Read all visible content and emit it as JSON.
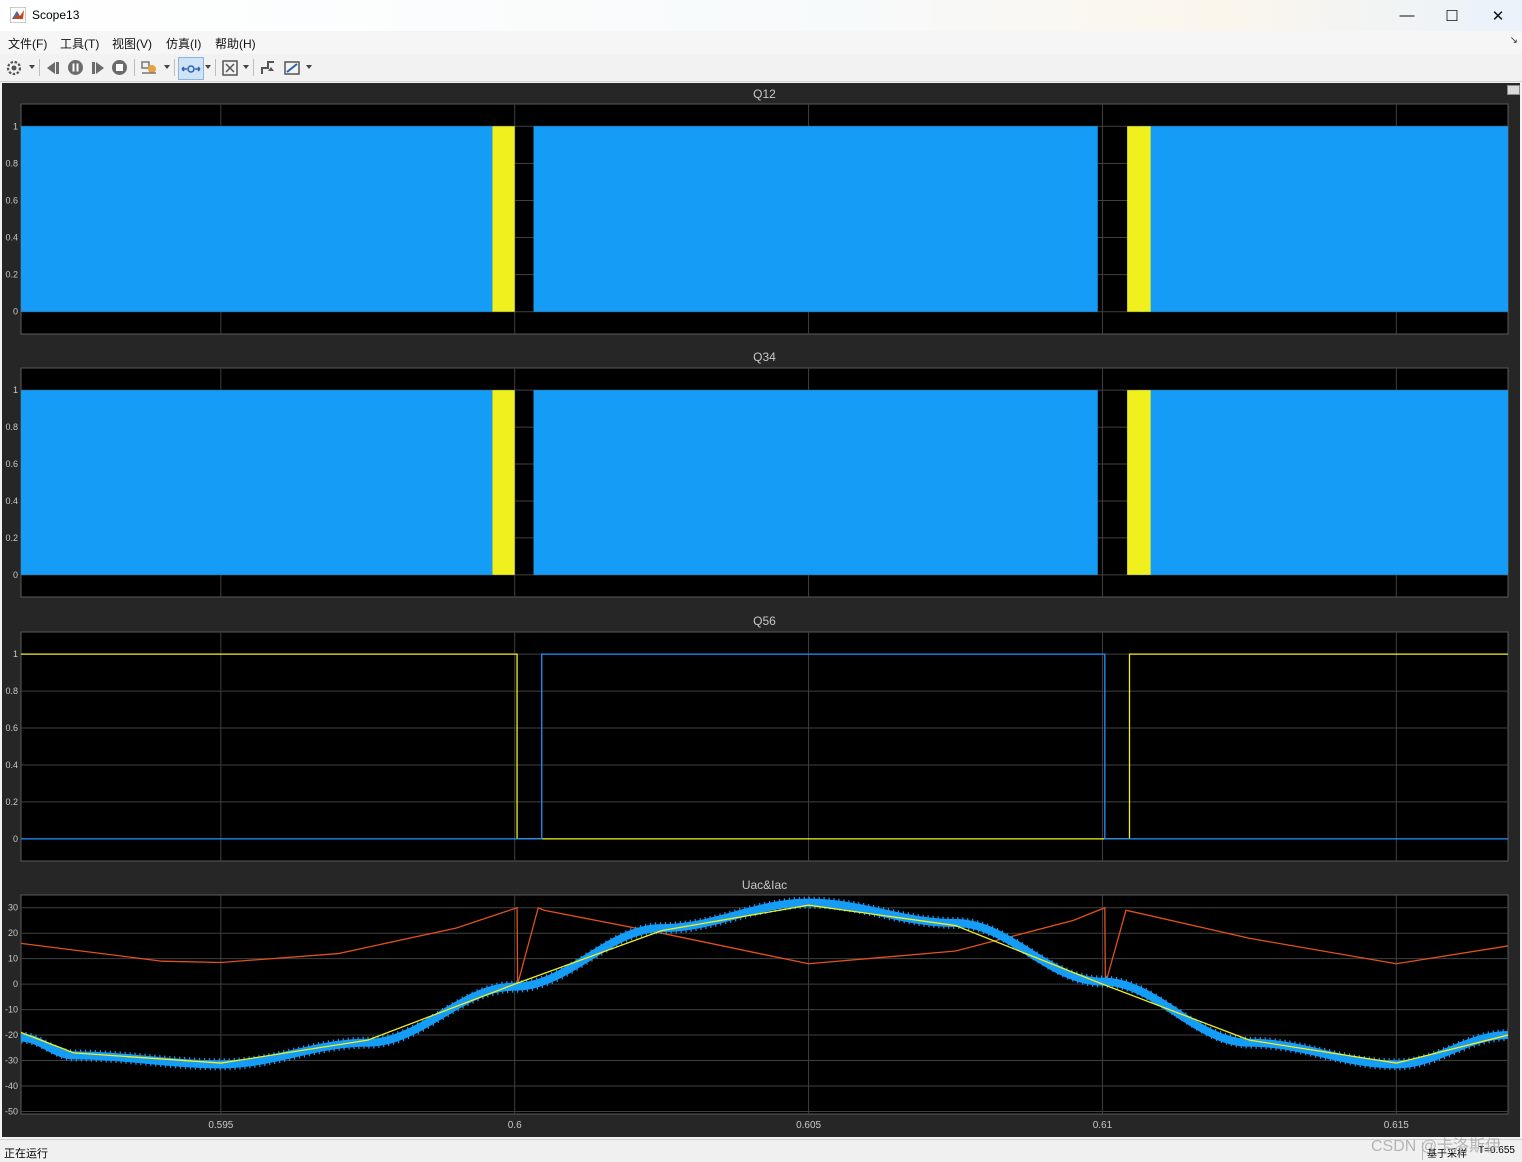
{
  "window": {
    "title": "Scope13",
    "minimize": "—",
    "maximize": "☐",
    "close": "✕"
  },
  "menu": [
    "文件(F)",
    "工具(T)",
    "视图(V)",
    "仿真(I)",
    "帮助(H)"
  ],
  "toolbar": [
    "settings-icon",
    "step-back-icon",
    "pause-icon",
    "step-forward-icon",
    "stop-icon",
    "highlight-icon",
    "zoom-icon",
    "autoscale-icon",
    "trigger-icon",
    "measure-icon"
  ],
  "colors": {
    "plot_bg": "#000000",
    "figure_bg": "#262626",
    "grid": "#404040",
    "axis_text": "#c8c8c8",
    "series_blue": "#149cf7",
    "series_yellow": "#f0f01e",
    "series_orange": "#e0511c",
    "series_blue_line": "#1e90ff"
  },
  "chart_data": [
    {
      "type": "line",
      "title": "Q12",
      "xlim": [
        0.5916,
        0.6169
      ],
      "ylim": [
        -0.12,
        1.12
      ],
      "yticks": [
        0,
        0.2,
        0.4,
        0.6,
        0.8,
        1
      ],
      "ytick_labels": [
        "0",
        "0.2",
        "0.4",
        "0.6",
        "0.8",
        "1"
      ],
      "xgrid": [
        0.595,
        0.6,
        0.605,
        0.61,
        0.615
      ],
      "series": [
        {
          "color": "#149cf7",
          "style": "pwm-fill",
          "intervals": [
            [
              0.5916,
              0.59962
            ],
            [
              0.60032,
              0.60992
            ],
            [
              0.61062,
              0.6169
            ]
          ]
        },
        {
          "color": "#f0f01e",
          "style": "pwm-fill",
          "intervals": [
            [
              0.59962,
              0.6
            ],
            [
              0.61042,
              0.61082
            ]
          ]
        }
      ]
    },
    {
      "type": "line",
      "title": "Q34",
      "xlim": [
        0.5916,
        0.6169
      ],
      "ylim": [
        -0.12,
        1.12
      ],
      "yticks": [
        0,
        0.2,
        0.4,
        0.6,
        0.8,
        1
      ],
      "ytick_labels": [
        "0",
        "0.2",
        "0.4",
        "0.6",
        "0.8",
        "1"
      ],
      "xgrid": [
        0.595,
        0.6,
        0.605,
        0.61,
        0.615
      ],
      "series": [
        {
          "color": "#149cf7",
          "style": "pwm-fill",
          "intervals": [
            [
              0.5916,
              0.59962
            ],
            [
              0.60032,
              0.60992
            ],
            [
              0.61062,
              0.6169
            ]
          ]
        },
        {
          "color": "#f0f01e",
          "style": "pwm-fill",
          "intervals": [
            [
              0.59962,
              0.6
            ],
            [
              0.61042,
              0.61082
            ]
          ]
        }
      ]
    },
    {
      "type": "line",
      "title": "Q56",
      "xlim": [
        0.5916,
        0.6169
      ],
      "ylim": [
        -0.12,
        1.12
      ],
      "yticks": [
        0,
        0.2,
        0.4,
        0.6,
        0.8,
        1
      ],
      "ytick_labels": [
        "0",
        "0.2",
        "0.4",
        "0.6",
        "0.8",
        "1"
      ],
      "xgrid": [
        0.595,
        0.6,
        0.605,
        0.61,
        0.615
      ],
      "series": [
        {
          "color": "#f0f01e",
          "x": [
            0.5916,
            0.60004,
            0.60004,
            0.61046,
            0.61046,
            0.6169
          ],
          "y": [
            1,
            1,
            0,
            0,
            1,
            1
          ]
        },
        {
          "color": "#1e90ff",
          "x": [
            0.5916,
            0.60046,
            0.60046,
            0.61004,
            0.61004,
            0.6169
          ],
          "y": [
            0,
            0,
            1,
            1,
            0,
            0
          ]
        }
      ]
    },
    {
      "type": "line",
      "title": "Uac&Iac",
      "xlim": [
        0.5916,
        0.6169
      ],
      "ylim": [
        -51,
        35
      ],
      "yticks": [
        -50,
        -40,
        -30,
        -20,
        -10,
        0,
        10,
        20,
        30
      ],
      "ytick_labels": [
        "-50",
        "-40",
        "-30",
        "-20",
        "-10",
        "0",
        "10",
        "20",
        "30"
      ],
      "xticks": [
        0.595,
        0.6,
        0.605,
        0.61,
        0.615
      ],
      "xtick_labels": [
        "0.595",
        "0.6",
        "0.605",
        "0.61",
        "0.615"
      ],
      "series": [
        {
          "color": "#e0511c",
          "x": [
            0.5916,
            0.594,
            0.595,
            0.597,
            0.599,
            0.60004,
            0.60005,
            0.6004,
            0.6005,
            0.6025,
            0.605,
            0.6075,
            0.6095,
            0.61004,
            0.61005,
            0.6104,
            0.6105,
            0.6125,
            0.615,
            0.6169
          ],
          "y": [
            16,
            9,
            8.5,
            12,
            22,
            30,
            0,
            30,
            29,
            20,
            8,
            13,
            25,
            30,
            0,
            29,
            28.5,
            18,
            8,
            15
          ]
        },
        {
          "color": "#149cf7",
          "style": "thick-noisy",
          "x": [
            0.5916,
            0.5925,
            0.595,
            0.5975,
            0.6,
            0.6025,
            0.605,
            0.6075,
            0.61,
            0.6125,
            0.615,
            0.6169
          ],
          "y": [
            -21,
            -28,
            -31.5,
            -23,
            -1,
            22,
            32,
            24,
            1,
            -23,
            -31.5,
            -20
          ]
        },
        {
          "color": "#f0f01e",
          "x": [
            0.5916,
            0.5925,
            0.595,
            0.5975,
            0.6,
            0.6025,
            0.605,
            0.6075,
            0.61,
            0.6125,
            0.615,
            0.6169
          ],
          "y": [
            -19,
            -27,
            -31,
            -22,
            0,
            21,
            31,
            23,
            0,
            -22,
            -31,
            -20
          ]
        }
      ]
    }
  ],
  "status": {
    "left": "正在运行",
    "sample": "基于采样",
    "time": "T=0.655"
  },
  "watermark": "CSDN @卡洛斯伊"
}
